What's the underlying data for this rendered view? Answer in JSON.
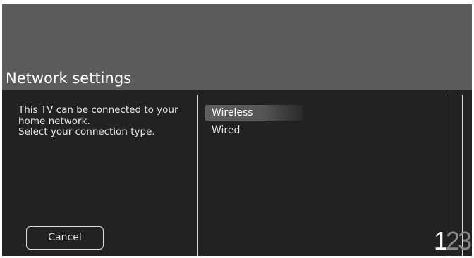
{
  "header": {
    "title": "Network settings"
  },
  "description": {
    "lines": [
      "This TV can be connected to your",
      "home network.",
      "Select your connection type."
    ]
  },
  "options": [
    {
      "label": "Wireless",
      "selected": true
    },
    {
      "label": "Wired",
      "selected": false
    }
  ],
  "cancel_button": {
    "label": "Cancel"
  },
  "steps": {
    "items": [
      "1",
      "2",
      "3"
    ],
    "current": "1"
  },
  "colors": {
    "header_bg": "#5b5b5b",
    "panel_bg": "#222222",
    "text": "#e6e6e6",
    "selected_bg": "#5e5e5e"
  }
}
